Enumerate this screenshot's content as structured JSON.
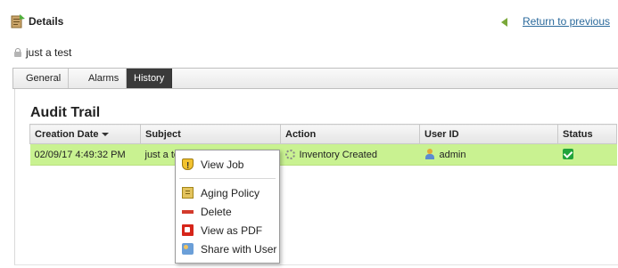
{
  "header": {
    "title": "Details",
    "return_link": "Return to previous"
  },
  "item": {
    "name": "just a test"
  },
  "tabs": [
    {
      "label": "General"
    },
    {
      "label": "Alarms"
    },
    {
      "label": "History",
      "active": true
    }
  ],
  "audit": {
    "title": "Audit Trail",
    "columns": [
      "Creation Date",
      "Subject",
      "Action",
      "User ID",
      "Status"
    ],
    "sort_column": "Creation Date",
    "sort_direction": "descending",
    "rows": [
      {
        "creation_date": "02/09/17 4:49:32 PM",
        "subject": "just a test",
        "action": "Inventory Created",
        "user_id": "admin",
        "status": "success"
      }
    ],
    "row_highlight_color": "#c9f291"
  },
  "context_menu": {
    "items": [
      {
        "label": "View Job",
        "icon": "shield-icon"
      },
      {
        "label": "Aging Policy",
        "icon": "policy-icon"
      },
      {
        "label": "Delete",
        "icon": "delete-icon"
      },
      {
        "label": "View as PDF",
        "icon": "pdf-icon"
      },
      {
        "label": "Share with User",
        "icon": "share-icon"
      }
    ]
  },
  "colors": {
    "link": "#2b6a9c",
    "active_tab": "#3a3a3a",
    "status_ok": "#21a33b"
  }
}
